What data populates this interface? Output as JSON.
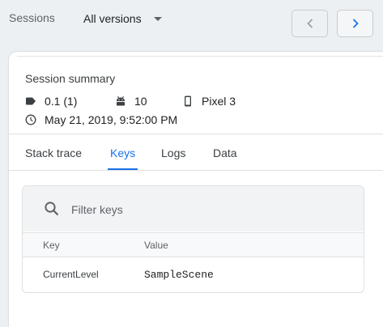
{
  "header": {
    "sessions_label": "Sessions",
    "version_select": "All versions",
    "prev_icon": "chevron-left-icon",
    "next_icon": "chevron-right-icon"
  },
  "summary": {
    "title": "Session summary",
    "version": "0.1 (1)",
    "android_version": "10",
    "device": "Pixel 3",
    "timestamp": "May 21, 2019, 9:52:00 PM"
  },
  "tabs": [
    {
      "label": "Stack trace",
      "active": false
    },
    {
      "label": "Keys",
      "active": true
    },
    {
      "label": "Logs",
      "active": false
    },
    {
      "label": "Data",
      "active": false
    }
  ],
  "keys": {
    "filter_placeholder": "Filter keys",
    "filter_value": "",
    "columns": {
      "key": "Key",
      "value": "Value"
    },
    "rows": [
      {
        "key": "CurrentLevel",
        "value": "SampleScene"
      }
    ]
  },
  "colors": {
    "accent": "#1a73e8",
    "background": "#edf0f2",
    "filter_bg": "#f1f3f4"
  }
}
